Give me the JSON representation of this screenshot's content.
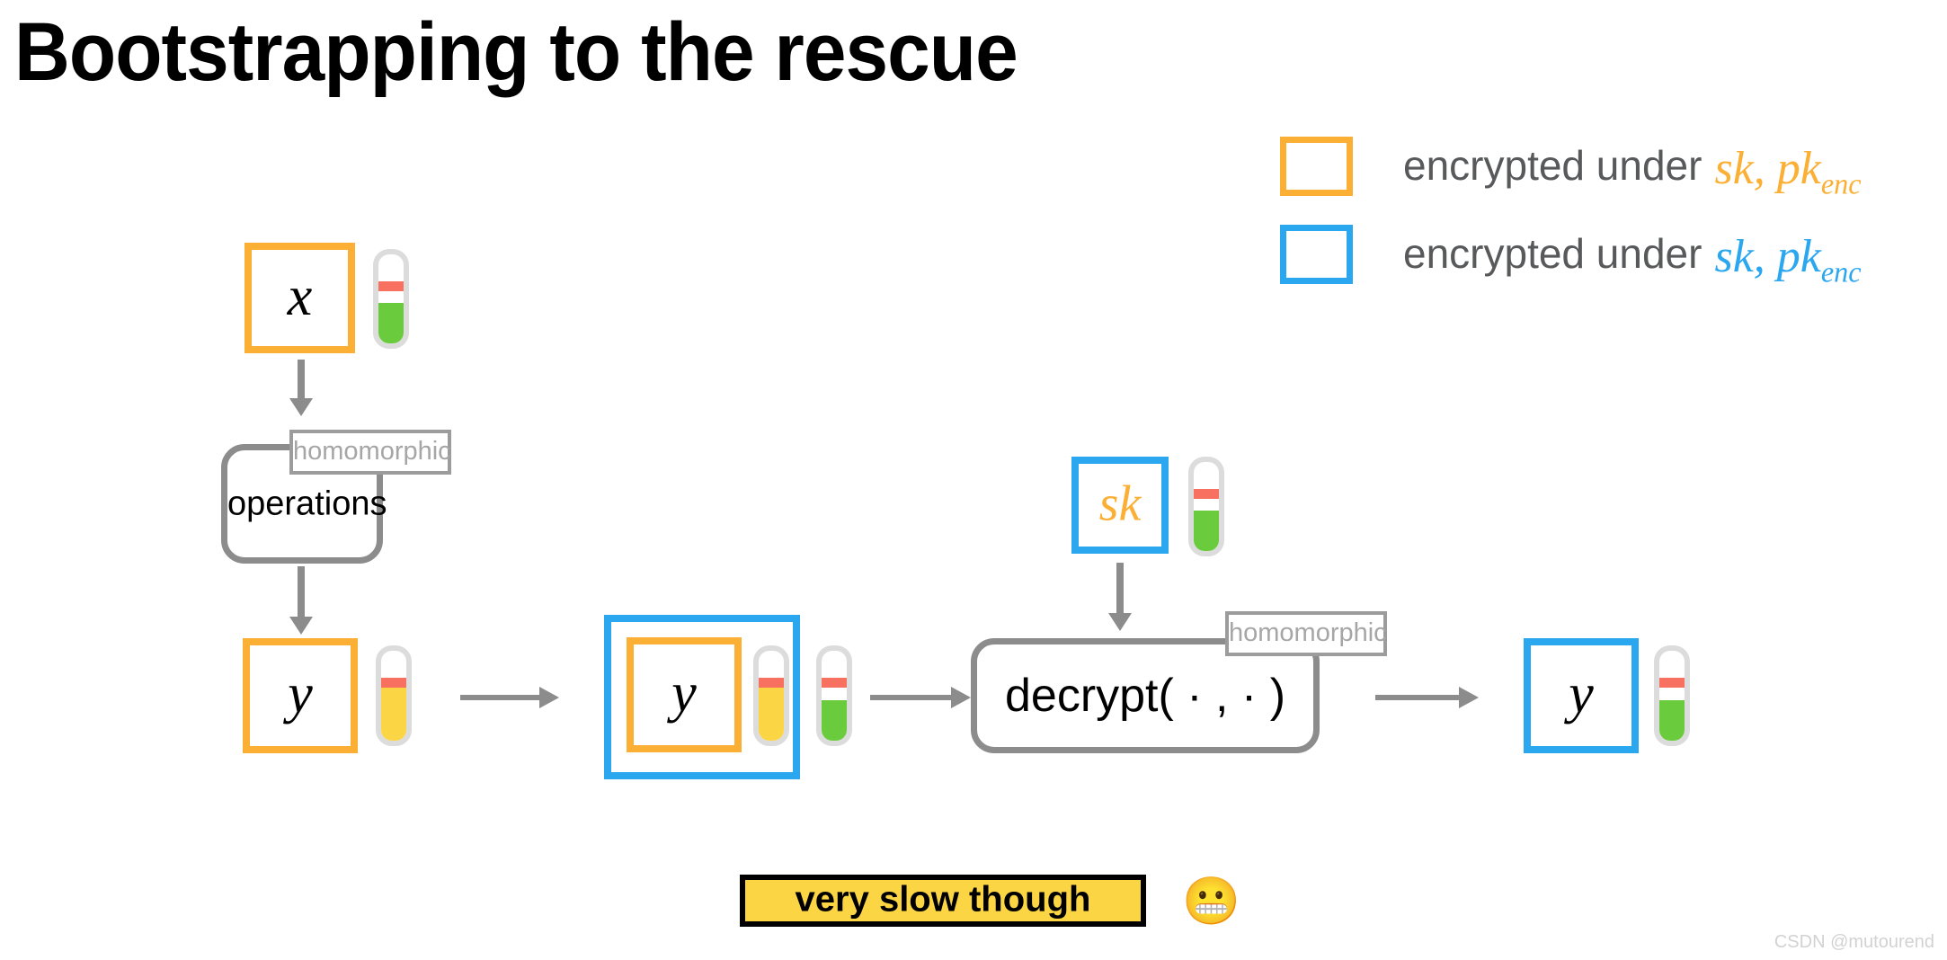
{
  "slide": {
    "title": "Bootstrapping to the rescue",
    "watermark": "CSDN @mutourend"
  },
  "legend": {
    "items": [
      {
        "swatch_color": "#FBAF34",
        "text": "encrypted under",
        "math_main": "sk, pk",
        "math_sub": "enc"
      },
      {
        "swatch_color": "#2BA7F0",
        "text": "encrypted under",
        "math_main": "sk, pk",
        "math_sub": "enc"
      }
    ]
  },
  "diagram": {
    "boxes": {
      "x_input": {
        "label": "x",
        "border_color": "#FBAF34"
      },
      "y_orange": {
        "label": "y",
        "border_color": "#FBAF34"
      },
      "y_nested_outer": {
        "label": "",
        "border_color": "#2BA7F0"
      },
      "y_nested_inner": {
        "label": "y",
        "border_color": "#FBAF34"
      },
      "sk_box": {
        "label": "sk",
        "border_color": "#2BA7F0"
      },
      "y_final": {
        "label": "y",
        "border_color": "#2BA7F0"
      }
    },
    "op_boxes": {
      "operations": {
        "label": "operations",
        "tag": "homomorphic"
      },
      "decrypt": {
        "label": "decrypt( · , · )",
        "tag": "homomorphic"
      }
    },
    "meters": [
      {
        "name": "x-noise-meter",
        "fill_color": "#6ACC3D",
        "fill_percent": 45,
        "threshold_percent": 70
      },
      {
        "name": "y-orange-noise-meter",
        "fill_color": "#FCD545",
        "fill_percent": 70,
        "threshold_percent": 70
      },
      {
        "name": "y-nested-inner-noise-meter",
        "fill_color": "#FCD545",
        "fill_percent": 70,
        "threshold_percent": 70
      },
      {
        "name": "y-nested-outer-noise-meter",
        "fill_color": "#6ACC3D",
        "fill_percent": 45,
        "threshold_percent": 70
      },
      {
        "name": "sk-noise-meter",
        "fill_color": "#6ACC3D",
        "fill_percent": 45,
        "threshold_percent": 70
      },
      {
        "name": "y-final-noise-meter",
        "fill_color": "#6ACC3D",
        "fill_percent": 45,
        "threshold_percent": 70
      }
    ]
  },
  "banner": {
    "label": "very slow though",
    "emoji": "😬",
    "background_color": "#FCD545"
  }
}
